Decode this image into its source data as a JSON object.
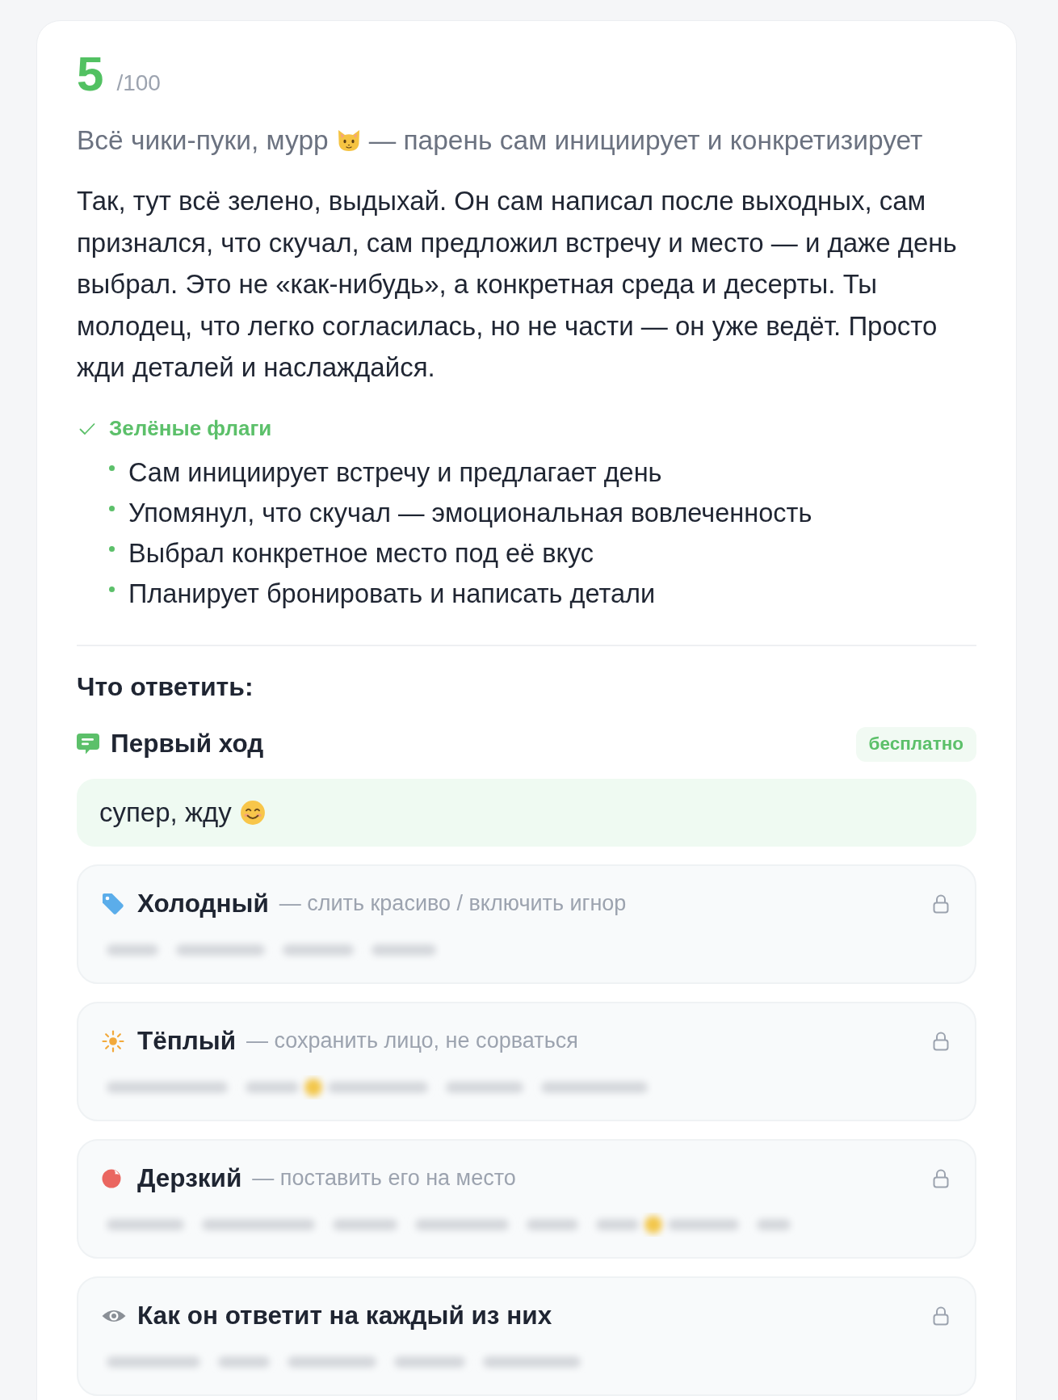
{
  "score": {
    "value": "5",
    "max": "/100"
  },
  "summary": {
    "text_before_icon": "Всё чики-пуки, мурр",
    "text_after_icon": "— парень сам инициирует и конкретизирует"
  },
  "analysis": "Так, тут всё зелено, выдыхай. Он сам написал после выходных, сам признался, что скучал, сам предложил встречу и место — и даже день выбрал. Это не «как-нибудь», а конкретная среда и десерты. Ты молодец, что легко согласилась, но не части — он уже ведёт. Просто жди деталей и наслаждайся.",
  "green_flags": {
    "title": "Зелёные флаги",
    "items": [
      "Сам инициирует встречу и предлагает день",
      "Упомянул, что скучал — эмоциональная вовлеченность",
      "Выбрал конкретное место под её вкус",
      "Планирует бронировать и написать детали"
    ]
  },
  "reply_section": {
    "title": "Что ответить:",
    "first_move": {
      "title": "Первый ход",
      "badge": "бесплатно",
      "reply": "супер, жду"
    },
    "options": [
      {
        "kind": "cold",
        "title": "Холодный",
        "subtitle": "— слить красиво / включить игнор",
        "locked": true
      },
      {
        "kind": "warm",
        "title": "Тёплый",
        "subtitle": "— сохранить лицо, не сорваться",
        "locked": true
      },
      {
        "kind": "bold",
        "title": "Дерзкий",
        "subtitle": "— поставить его на место",
        "locked": true
      },
      {
        "kind": "reaction",
        "title": "Как он ответит на каждый из них",
        "locked": true
      }
    ]
  }
}
